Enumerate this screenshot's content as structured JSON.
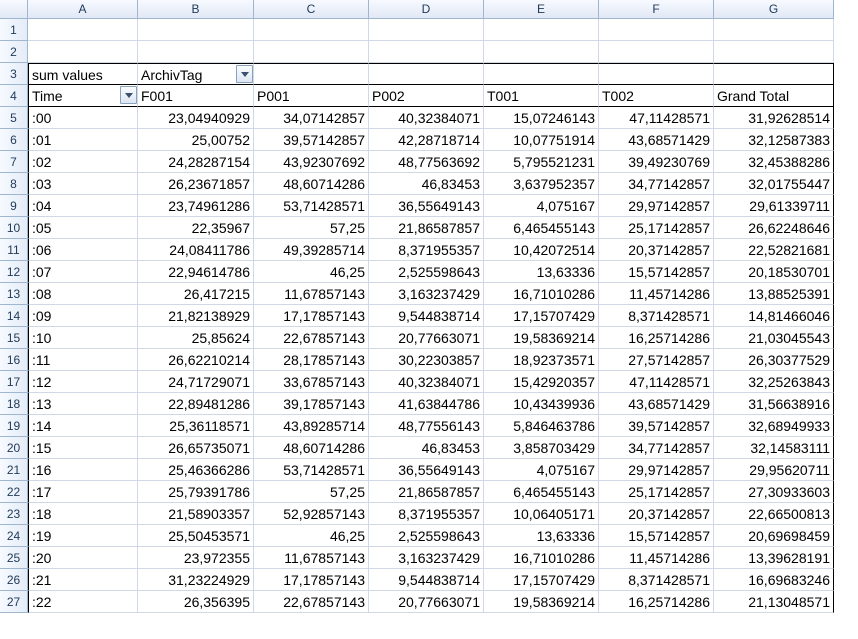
{
  "columns": [
    "A",
    "B",
    "C",
    "D",
    "E",
    "F",
    "G"
  ],
  "pivot": {
    "measure_label": "sum values",
    "column_field": "ArchivTag",
    "row_field": "Time",
    "column_headers": [
      "F001",
      "P001",
      "P002",
      "T001",
      "T002"
    ],
    "grand_total_label": "Grand Total"
  },
  "rows": [
    {
      "n": 5,
      "time": ":00",
      "v": [
        "23,04940929",
        "34,07142857",
        "40,32384071",
        "15,07246143",
        "47,11428571",
        "31,92628514"
      ]
    },
    {
      "n": 6,
      "time": ":01",
      "v": [
        "25,00752",
        "39,57142857",
        "42,28718714",
        "10,07751914",
        "43,68571429",
        "32,12587383"
      ]
    },
    {
      "n": 7,
      "time": ":02",
      "v": [
        "24,28287154",
        "43,92307692",
        "48,77563692",
        "5,795521231",
        "39,49230769",
        "32,45388286"
      ]
    },
    {
      "n": 8,
      "time": ":03",
      "v": [
        "26,23671857",
        "48,60714286",
        "46,83453",
        "3,637952357",
        "34,77142857",
        "32,01755447"
      ]
    },
    {
      "n": 9,
      "time": ":04",
      "v": [
        "23,74961286",
        "53,71428571",
        "36,55649143",
        "4,075167",
        "29,97142857",
        "29,61339711"
      ]
    },
    {
      "n": 10,
      "time": ":05",
      "v": [
        "22,35967",
        "57,25",
        "21,86587857",
        "6,465455143",
        "25,17142857",
        "26,62248646"
      ]
    },
    {
      "n": 11,
      "time": ":06",
      "v": [
        "24,08411786",
        "49,39285714",
        "8,371955357",
        "10,42072514",
        "20,37142857",
        "22,52821681"
      ]
    },
    {
      "n": 12,
      "time": ":07",
      "v": [
        "22,94614786",
        "46,25",
        "2,525598643",
        "13,63336",
        "15,57142857",
        "20,18530701"
      ]
    },
    {
      "n": 13,
      "time": ":08",
      "v": [
        "26,417215",
        "11,67857143",
        "3,163237429",
        "16,71010286",
        "11,45714286",
        "13,88525391"
      ]
    },
    {
      "n": 14,
      "time": ":09",
      "v": [
        "21,82138929",
        "17,17857143",
        "9,544838714",
        "17,15707429",
        "8,371428571",
        "14,81466046"
      ]
    },
    {
      "n": 15,
      "time": ":10",
      "v": [
        "25,85624",
        "22,67857143",
        "20,77663071",
        "19,58369214",
        "16,25714286",
        "21,03045543"
      ]
    },
    {
      "n": 16,
      "time": ":11",
      "v": [
        "26,62210214",
        "28,17857143",
        "30,22303857",
        "18,92373571",
        "27,57142857",
        "26,30377529"
      ]
    },
    {
      "n": 17,
      "time": ":12",
      "v": [
        "24,71729071",
        "33,67857143",
        "40,32384071",
        "15,42920357",
        "47,11428571",
        "32,25263843"
      ]
    },
    {
      "n": 18,
      "time": ":13",
      "v": [
        "22,89481286",
        "39,17857143",
        "41,63844786",
        "10,43439936",
        "43,68571429",
        "31,56638916"
      ]
    },
    {
      "n": 19,
      "time": ":14",
      "v": [
        "25,36118571",
        "43,89285714",
        "48,77556143",
        "5,846463786",
        "39,57142857",
        "32,68949933"
      ]
    },
    {
      "n": 20,
      "time": ":15",
      "v": [
        "26,65735071",
        "48,60714286",
        "46,83453",
        "3,858703429",
        "34,77142857",
        "32,14583111"
      ]
    },
    {
      "n": 21,
      "time": ":16",
      "v": [
        "25,46366286",
        "53,71428571",
        "36,55649143",
        "4,075167",
        "29,97142857",
        "29,95620711"
      ]
    },
    {
      "n": 22,
      "time": ":17",
      "v": [
        "25,79391786",
        "57,25",
        "21,86587857",
        "6,465455143",
        "25,17142857",
        "27,30933603"
      ]
    },
    {
      "n": 23,
      "time": ":18",
      "v": [
        "21,58903357",
        "52,92857143",
        "8,371955357",
        "10,06405171",
        "20,37142857",
        "22,66500813"
      ]
    },
    {
      "n": 24,
      "time": ":19",
      "v": [
        "25,50453571",
        "46,25",
        "2,525598643",
        "13,63336",
        "15,57142857",
        "20,69698459"
      ]
    },
    {
      "n": 25,
      "time": ":20",
      "v": [
        "23,972355",
        "11,67857143",
        "3,163237429",
        "16,71010286",
        "11,45714286",
        "13,39628191"
      ]
    },
    {
      "n": 26,
      "time": ":21",
      "v": [
        "31,23224929",
        "17,17857143",
        "9,544838714",
        "17,15707429",
        "8,371428571",
        "16,69683246"
      ]
    },
    {
      "n": 27,
      "time": ":22",
      "v": [
        "26,356395",
        "22,67857143",
        "20,77663071",
        "19,58369214",
        "16,25714286",
        "21,13048571"
      ]
    }
  ],
  "chart_data": {
    "type": "table",
    "title": "sum values by Time and ArchivTag",
    "row_field": "Time",
    "column_field": "ArchivTag",
    "columns": [
      "F001",
      "P001",
      "P002",
      "T001",
      "T002",
      "Grand Total"
    ],
    "rows": [
      {
        "Time": ":00",
        "F001": 23.04940929,
        "P001": 34.07142857,
        "P002": 40.32384071,
        "T001": 15.07246143,
        "T002": 47.11428571,
        "Grand Total": 31.92628514
      },
      {
        "Time": ":01",
        "F001": 25.00752,
        "P001": 39.57142857,
        "P002": 42.28718714,
        "T001": 10.07751914,
        "T002": 43.68571429,
        "Grand Total": 32.12587383
      },
      {
        "Time": ":02",
        "F001": 24.28287154,
        "P001": 43.92307692,
        "P002": 48.77563692,
        "T001": 5.795521231,
        "T002": 39.49230769,
        "Grand Total": 32.45388286
      },
      {
        "Time": ":03",
        "F001": 26.23671857,
        "P001": 48.60714286,
        "P002": 46.83453,
        "T001": 3.637952357,
        "T002": 34.77142857,
        "Grand Total": 32.01755447
      },
      {
        "Time": ":04",
        "F001": 23.74961286,
        "P001": 53.71428571,
        "P002": 36.55649143,
        "T001": 4.075167,
        "T002": 29.97142857,
        "Grand Total": 29.61339711
      },
      {
        "Time": ":05",
        "F001": 22.35967,
        "P001": 57.25,
        "P002": 21.86587857,
        "T001": 6.465455143,
        "T002": 25.17142857,
        "Grand Total": 26.62248646
      },
      {
        "Time": ":06",
        "F001": 24.08411786,
        "P001": 49.39285714,
        "P002": 8.371955357,
        "T001": 10.42072514,
        "T002": 20.37142857,
        "Grand Total": 22.52821681
      },
      {
        "Time": ":07",
        "F001": 22.94614786,
        "P001": 46.25,
        "P002": 2.525598643,
        "T001": 13.63336,
        "T002": 15.57142857,
        "Grand Total": 20.18530701
      },
      {
        "Time": ":08",
        "F001": 26.417215,
        "P001": 11.67857143,
        "P002": 3.163237429,
        "T001": 16.71010286,
        "T002": 11.45714286,
        "Grand Total": 13.88525391
      },
      {
        "Time": ":09",
        "F001": 21.82138929,
        "P001": 17.17857143,
        "P002": 9.544838714,
        "T001": 17.15707429,
        "T002": 8.371428571,
        "Grand Total": 14.81466046
      },
      {
        "Time": ":10",
        "F001": 25.85624,
        "P001": 22.67857143,
        "P002": 20.77663071,
        "T001": 19.58369214,
        "T002": 16.25714286,
        "Grand Total": 21.03045543
      },
      {
        "Time": ":11",
        "F001": 26.62210214,
        "P001": 28.17857143,
        "P002": 30.22303857,
        "T001": 18.92373571,
        "T002": 27.57142857,
        "Grand Total": 26.30377529
      },
      {
        "Time": ":12",
        "F001": 24.71729071,
        "P001": 33.67857143,
        "P002": 40.32384071,
        "T001": 15.42920357,
        "T002": 47.11428571,
        "Grand Total": 32.25263843
      },
      {
        "Time": ":13",
        "F001": 22.89481286,
        "P001": 39.17857143,
        "P002": 41.63844786,
        "T001": 10.43439936,
        "T002": 43.68571429,
        "Grand Total": 31.56638916
      },
      {
        "Time": ":14",
        "F001": 25.36118571,
        "P001": 43.89285714,
        "P002": 48.77556143,
        "T001": 5.846463786,
        "T002": 39.57142857,
        "Grand Total": 32.68949933
      },
      {
        "Time": ":15",
        "F001": 26.65735071,
        "P001": 48.60714286,
        "P002": 46.83453,
        "T001": 3.858703429,
        "T002": 34.77142857,
        "Grand Total": 32.14583111
      },
      {
        "Time": ":16",
        "F001": 25.46366286,
        "P001": 53.71428571,
        "P002": 36.55649143,
        "T001": 4.075167,
        "T002": 29.97142857,
        "Grand Total": 29.95620711
      },
      {
        "Time": ":17",
        "F001": 25.79391786,
        "P001": 57.25,
        "P002": 21.86587857,
        "T001": 6.465455143,
        "T002": 25.17142857,
        "Grand Total": 27.30933603
      },
      {
        "Time": ":18",
        "F001": 21.58903357,
        "P001": 52.92857143,
        "P002": 8.371955357,
        "T001": 10.06405171,
        "T002": 20.37142857,
        "Grand Total": 22.66500813
      },
      {
        "Time": ":19",
        "F001": 25.50453571,
        "P001": 46.25,
        "P002": 2.525598643,
        "T001": 13.63336,
        "T002": 15.57142857,
        "Grand Total": 20.69698459
      },
      {
        "Time": ":20",
        "F001": 23.972355,
        "P001": 11.67857143,
        "P002": 3.163237429,
        "T001": 16.71010286,
        "T002": 11.45714286,
        "Grand Total": 13.39628191
      },
      {
        "Time": ":21",
        "F001": 31.23224929,
        "P001": 17.17857143,
        "P002": 9.544838714,
        "T001": 17.15707429,
        "T002": 8.371428571,
        "Grand Total": 16.69683246
      },
      {
        "Time": ":22",
        "F001": 26.356395,
        "P001": 22.67857143,
        "P002": 20.77663071,
        "T001": 19.58369214,
        "T002": 16.25714286,
        "Grand Total": 21.13048571
      }
    ]
  }
}
